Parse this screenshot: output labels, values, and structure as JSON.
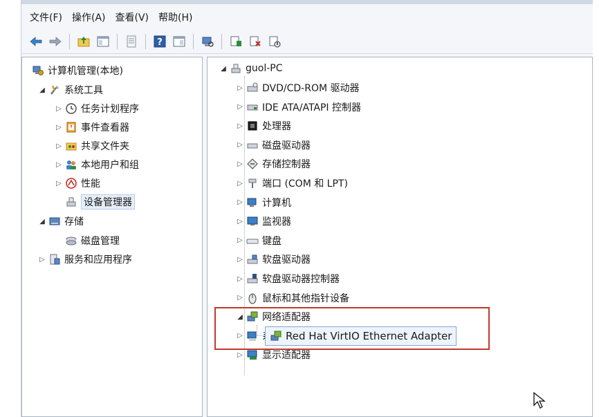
{
  "menu": [
    "文件(F)",
    "操作(A)",
    "查看(V)",
    "帮助(H)"
  ],
  "left_tree": [
    {
      "label": "计算机管理(本地)",
      "icon": "computer-management-icon",
      "arrow": ""
    },
    {
      "label": "系统工具",
      "icon": "system-tools-icon",
      "arrow": "open"
    },
    {
      "label": "任务计划程序",
      "icon": "clock-icon",
      "arrow": "closed"
    },
    {
      "label": "事件查看器",
      "icon": "event-viewer-icon",
      "arrow": "closed"
    },
    {
      "label": "共享文件夹",
      "icon": "shared-folder-icon",
      "arrow": "closed"
    },
    {
      "label": "本地用户和组",
      "icon": "users-icon",
      "arrow": "closed"
    },
    {
      "label": "性能",
      "icon": "performance-icon",
      "arrow": "closed"
    },
    {
      "label": "设备管理器",
      "icon": "device-manager-icon",
      "arrow": "",
      "selected": true
    },
    {
      "label": "存储",
      "icon": "storage-icon",
      "arrow": "open"
    },
    {
      "label": "磁盘管理",
      "icon": "disk-management-icon",
      "arrow": ""
    },
    {
      "label": "服务和应用程序",
      "icon": "services-icon",
      "arrow": "closed"
    }
  ],
  "right_tree": {
    "root": "guol-PC",
    "items": [
      {
        "label": "DVD/CD-ROM 驱动器",
        "icon": "dvd-drive-icon"
      },
      {
        "label": "IDE ATA/ATAPI 控制器",
        "icon": "ide-controller-icon"
      },
      {
        "label": "处理器",
        "icon": "processor-icon"
      },
      {
        "label": "磁盘驱动器",
        "icon": "disk-drive-icon"
      },
      {
        "label": "存储控制器",
        "icon": "storage-controller-icon"
      },
      {
        "label": "端口 (COM 和 LPT)",
        "icon": "port-icon"
      },
      {
        "label": "计算机",
        "icon": "computer-icon"
      },
      {
        "label": "监视器",
        "icon": "monitor-icon"
      },
      {
        "label": "键盘",
        "icon": "keyboard-icon"
      },
      {
        "label": "软盘驱动器",
        "icon": "floppy-drive-icon"
      },
      {
        "label": "软盘驱动器控制器",
        "icon": "floppy-controller-icon"
      },
      {
        "label": "鼠标和其他指针设备",
        "icon": "mouse-icon"
      },
      {
        "label": "网络适配器",
        "icon": "network-adapter-icon",
        "open": true
      },
      {
        "label": "系统设备",
        "icon": "system-devices-icon"
      },
      {
        "label": "显示适配器",
        "icon": "display-adapter-icon"
      }
    ],
    "adapter_child": "Red Hat VirtIO Ethernet Adapter"
  },
  "colors": {
    "highlight": "#c0392b",
    "selection": "#e5eef8"
  }
}
